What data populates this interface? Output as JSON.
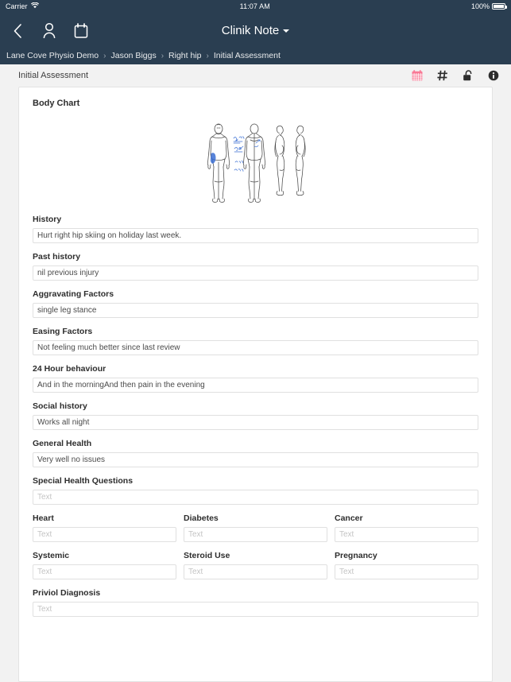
{
  "status_bar": {
    "carrier": "Carrier",
    "wifi_icon": "wifi-icon",
    "time": "11:07 AM",
    "battery_percent": "100%",
    "battery_icon": "battery-full-icon"
  },
  "navbar": {
    "back_icon": "chevron-left-icon",
    "person_icon": "person-icon",
    "calendar_icon": "calendar-icon",
    "title": "Clinik Note",
    "dropdown_icon": "caret-down-icon"
  },
  "breadcrumb": {
    "separator": "›",
    "items": [
      {
        "label": "Lane Cove Physio Demo"
      },
      {
        "label": "Jason Biggs"
      },
      {
        "label": "Right hip"
      },
      {
        "label": "Initial Assessment"
      }
    ]
  },
  "content_header": {
    "title": "Initial Assessment",
    "icons": [
      {
        "name": "calendar-pink-icon",
        "color": "#f97a96"
      },
      {
        "name": "hash-icon",
        "color": "#2d2d2d"
      },
      {
        "name": "unlock-icon",
        "color": "#2d2d2d"
      },
      {
        "name": "info-icon",
        "color": "#2d2d2d"
      }
    ]
  },
  "card": {
    "title": "Body Chart",
    "body_chart": {
      "name": "body-chart-diagram",
      "figures": [
        "front",
        "back",
        "side-left",
        "side-right"
      ],
      "annotation_color": "#3b6fd4",
      "annotations": [
        "Pain",
        "Ache",
        "P&N",
        "Numb"
      ]
    },
    "fields": [
      {
        "label": "History",
        "value": "Hurt right hip skiing on holiday last week.",
        "placeholder": "Text",
        "name": "history"
      },
      {
        "label": "Past history",
        "value": "nil previous injury",
        "placeholder": "Text",
        "name": "past-history"
      },
      {
        "label": "Aggravating Factors",
        "value": "single leg stance",
        "placeholder": "Text",
        "name": "aggravating-factors"
      },
      {
        "label": "Easing Factors",
        "value": "Not feeling much better since last review",
        "placeholder": "Text",
        "name": "easing-factors"
      },
      {
        "label": "24 Hour behaviour",
        "value": "And in the morningAnd then pain in the evening",
        "placeholder": "Text",
        "name": "24-hour-behaviour"
      },
      {
        "label": "Social history",
        "value": "Works all night",
        "placeholder": "Text",
        "name": "social-history"
      },
      {
        "label": "General Health",
        "value": "Very well no issues",
        "placeholder": "Text",
        "name": "general-health"
      },
      {
        "label": "Special Health Questions",
        "value": "",
        "placeholder": "Text",
        "name": "special-health-questions"
      }
    ],
    "grid_fields_row1": [
      {
        "label": "Heart",
        "value": "",
        "placeholder": "Text",
        "name": "heart"
      },
      {
        "label": "Diabetes",
        "value": "",
        "placeholder": "Text",
        "name": "diabetes"
      },
      {
        "label": "Cancer",
        "value": "",
        "placeholder": "Text",
        "name": "cancer"
      }
    ],
    "grid_fields_row2": [
      {
        "label": "Systemic",
        "value": "",
        "placeholder": "Text",
        "name": "systemic"
      },
      {
        "label": "Steroid Use",
        "value": "",
        "placeholder": "Text",
        "name": "steroid-use"
      },
      {
        "label": "Pregnancy",
        "value": "",
        "placeholder": "Text",
        "name": "pregnancy"
      }
    ],
    "final_field": {
      "label": "Priviol Diagnosis",
      "value": "",
      "placeholder": "Text",
      "name": "priviol-diagnosis"
    }
  },
  "colors": {
    "navbar": "#2a3e51",
    "page_bg": "#f2f2f2",
    "card_bg": "#ffffff",
    "accent_pink": "#f97a96",
    "field_border": "#e0e0e0"
  }
}
